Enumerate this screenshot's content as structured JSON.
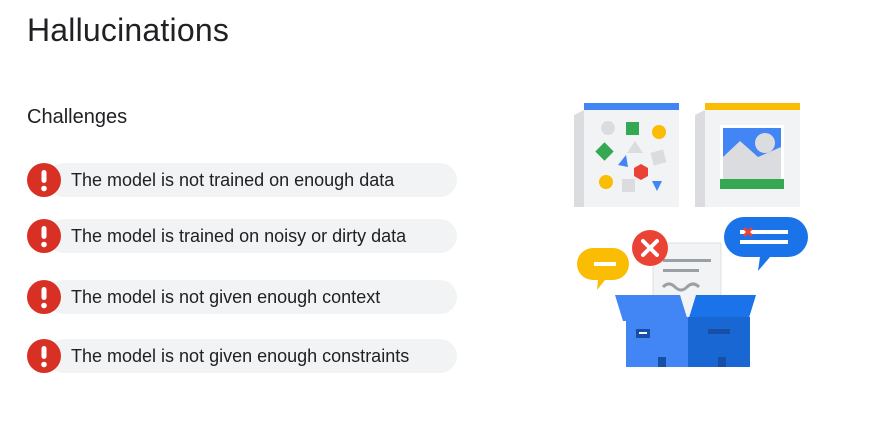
{
  "slide": {
    "title": "Hallucinations",
    "subtitle": "Challenges"
  },
  "challenges": [
    {
      "text": "The model is not trained on enough data",
      "icon": "alert-icon"
    },
    {
      "text": "The model is trained on noisy or dirty data",
      "icon": "alert-icon"
    },
    {
      "text": "The model is not given enough context",
      "icon": "alert-icon"
    },
    {
      "text": "The model is not given enough constraints",
      "icon": "alert-icon"
    }
  ],
  "colors": {
    "alert_red": "#d93025",
    "pill_background": "#f1f3f4",
    "google_blue": "#4285f4",
    "google_yellow": "#fbbc04",
    "google_green": "#34a853"
  },
  "illustration": {
    "description_icon": "open-box-with-documents-illustration"
  }
}
